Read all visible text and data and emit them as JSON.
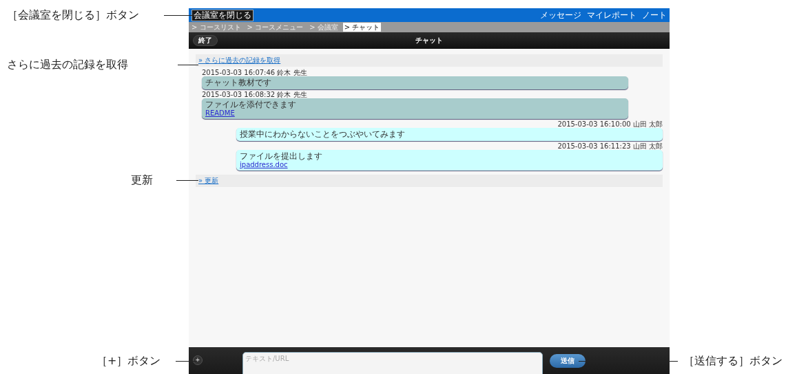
{
  "annotations": [
    {
      "text": "［会議室を閉じる］ボタン"
    },
    {
      "text": "さらに過去の記録を取得"
    },
    {
      "text": "更新"
    },
    {
      "text": "［+］ボタン"
    },
    {
      "text": "［送信する］ボタン"
    }
  ],
  "top_bar": {
    "close_button": "会議室を閉じる",
    "links": [
      "メッセージ",
      "マイレポート",
      "ノート"
    ]
  },
  "breadcrumbs": [
    {
      "label": "> コースリスト",
      "selected": false
    },
    {
      "label": "> コースメニュー",
      "selected": false
    },
    {
      "label": "> 会議室",
      "selected": false
    },
    {
      "label": "> チャット",
      "selected": true
    }
  ],
  "header": {
    "end_button": "終了",
    "title": "チャット"
  },
  "older_link": "» さらに過去の記録を取得",
  "messages": [
    {
      "kind": "received",
      "meta": "2015-03-03 16:07:46 鈴木 先生",
      "text": "チャット教材です"
    },
    {
      "kind": "received",
      "meta": "2015-03-03 16:08:32 鈴木 先生",
      "text": "ファイルを添付できます",
      "link": "README"
    },
    {
      "kind": "sent",
      "meta": "2015-03-03 16:10:00 山田 太郎",
      "text": "授業中にわからないことをつぶやいてみます"
    },
    {
      "kind": "sent",
      "meta": "2015-03-03 16:11:23 山田 太郎",
      "text": "ファイルを提出します",
      "link": "ipaddress.doc"
    }
  ],
  "refresh_link": "» 更新",
  "composer": {
    "plus_button": "+",
    "placeholder": "テキスト/URL",
    "send_button": "送信"
  }
}
